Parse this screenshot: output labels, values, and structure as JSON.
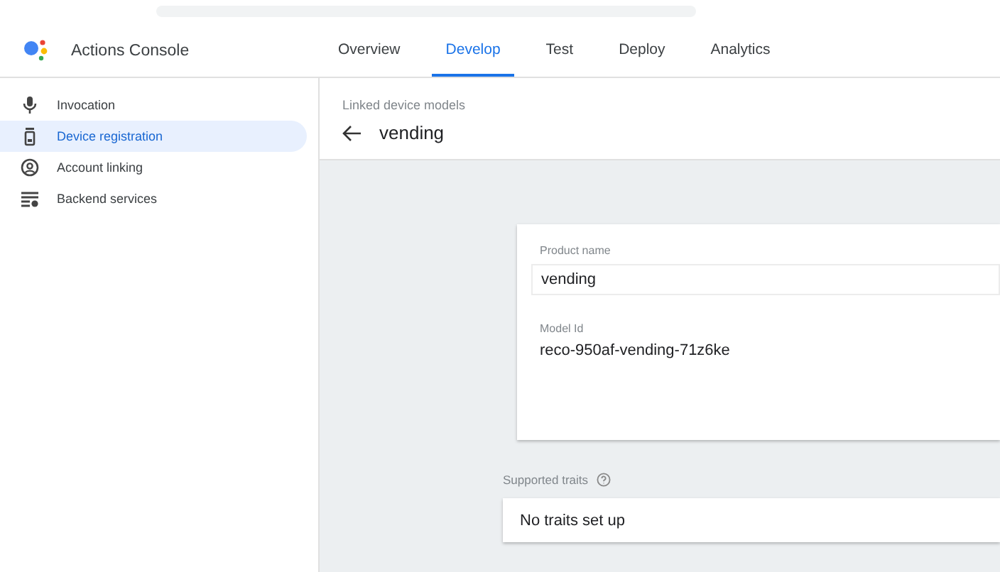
{
  "app": {
    "title": "Actions Console"
  },
  "tabs": [
    {
      "label": "Overview",
      "selected": false
    },
    {
      "label": "Develop",
      "selected": true
    },
    {
      "label": "Test",
      "selected": false
    },
    {
      "label": "Deploy",
      "selected": false
    },
    {
      "label": "Analytics",
      "selected": false
    }
  ],
  "sidebar": {
    "items": [
      {
        "label": "Invocation",
        "kind": "mic",
        "selected": false
      },
      {
        "label": "Device registration",
        "kind": "device",
        "selected": true
      },
      {
        "label": "Account linking",
        "kind": "account",
        "selected": false
      },
      {
        "label": "Backend services",
        "kind": "backend",
        "selected": false
      }
    ]
  },
  "page_header": {
    "breadcrumb": "Linked device models",
    "title": "vending"
  },
  "model_card": {
    "product_name": {
      "label": "Product name",
      "value": "vending"
    },
    "model_id": {
      "label": "Model Id",
      "value": "reco-950af-vending-71z6ke"
    }
  },
  "traits": {
    "label": "Supported traits",
    "empty_text": "No traits set up"
  }
}
